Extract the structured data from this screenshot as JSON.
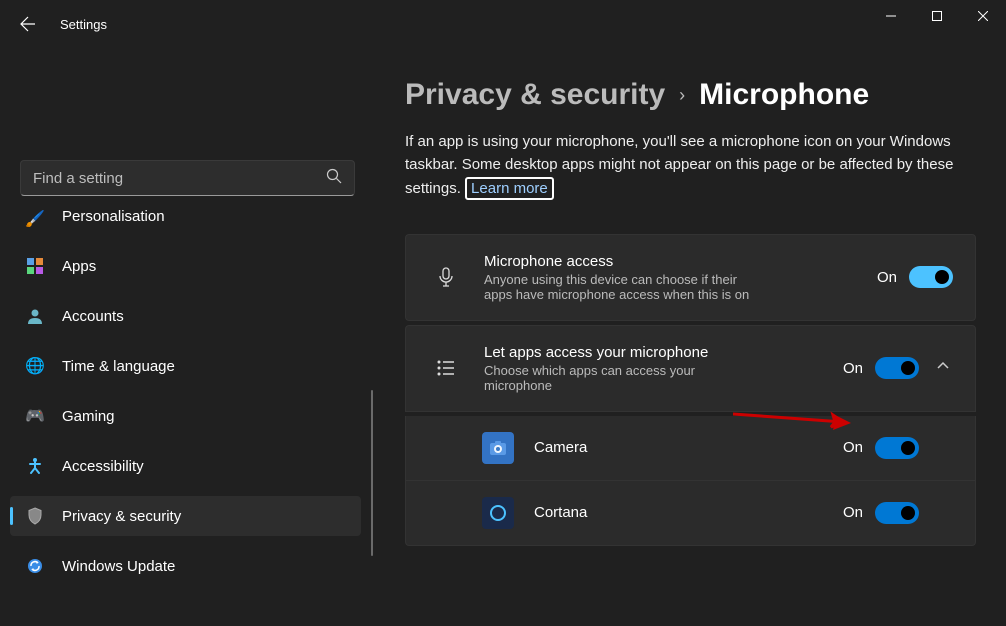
{
  "app_title": "Settings",
  "search": {
    "placeholder": "Find a setting"
  },
  "nav": {
    "items": [
      {
        "label": "Personalisation"
      },
      {
        "label": "Apps"
      },
      {
        "label": "Accounts"
      },
      {
        "label": "Time & language"
      },
      {
        "label": "Gaming"
      },
      {
        "label": "Accessibility"
      },
      {
        "label": "Privacy & security"
      },
      {
        "label": "Windows Update"
      }
    ]
  },
  "breadcrumb": {
    "parent": "Privacy & security",
    "current": "Microphone"
  },
  "description": "If an app is using your microphone, you'll see a microphone icon on your Windows taskbar. Some desktop apps might not appear on this page or be affected by these settings.",
  "learn_more": "Learn more",
  "settings": {
    "mic_access": {
      "title": "Microphone access",
      "sub": "Anyone using this device can choose if their apps have microphone access when this is on",
      "state": "On"
    },
    "let_apps": {
      "title": "Let apps access your microphone",
      "sub": "Choose which apps can access your microphone",
      "state": "On"
    }
  },
  "apps": [
    {
      "name": "Camera",
      "state": "On"
    },
    {
      "name": "Cortana",
      "state": "On"
    }
  ],
  "colors": {
    "accent": "#4cc2ff",
    "accent2": "#0078d4",
    "annotation": "#c00000"
  }
}
